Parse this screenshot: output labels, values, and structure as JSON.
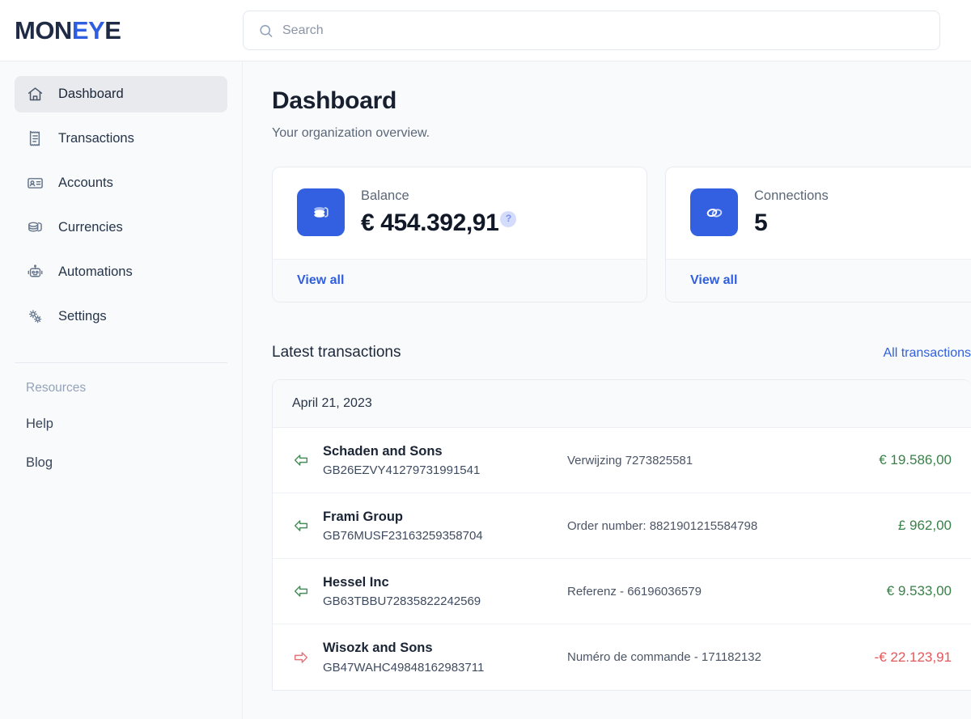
{
  "brand": {
    "name_prefix": "MON",
    "name_accent": "EY",
    "name_suffix": "E",
    "full": "MONEYE",
    "accent_color": "#2f5fe0",
    "dark_color": "#1f2a44"
  },
  "search": {
    "placeholder": "Search",
    "value": "",
    "icon": "search-icon"
  },
  "sidebar": {
    "items": [
      {
        "label": "Dashboard",
        "icon": "home-icon",
        "active": true
      },
      {
        "label": "Transactions",
        "icon": "receipt-icon",
        "active": false
      },
      {
        "label": "Accounts",
        "icon": "id-card-icon",
        "active": false
      },
      {
        "label": "Currencies",
        "icon": "coins-icon",
        "active": false
      },
      {
        "label": "Automations",
        "icon": "robot-icon",
        "active": false
      },
      {
        "label": "Settings",
        "icon": "gears-icon",
        "active": false
      }
    ],
    "resources_label": "Resources",
    "resources": [
      {
        "label": "Help"
      },
      {
        "label": "Blog"
      }
    ]
  },
  "page": {
    "title": "Dashboard",
    "subtitle": "Your organization overview."
  },
  "cards": [
    {
      "label": "Balance",
      "value": "€ 454.392,91",
      "icon": "coins-stack-icon",
      "icon_bg": "#3260e0",
      "help_badge": "?",
      "footer_link": "View all"
    },
    {
      "label": "Connections",
      "value": "5",
      "icon": "link-icon",
      "icon_bg": "#3260e0",
      "help_badge": null,
      "footer_link": "View all"
    }
  ],
  "transactions": {
    "heading": "Latest transactions",
    "all_link": "All transactions",
    "date_group": "April 21, 2023",
    "rows": [
      {
        "direction": "in",
        "name": "Schaden and Sons",
        "iban": "GB26EZVY41279731991541",
        "reference": "Verwijzing 7273825581",
        "amount": "€ 19.586,00",
        "amount_color": "#3a8049"
      },
      {
        "direction": "in",
        "name": "Frami Group",
        "iban": "GB76MUSF23163259358704",
        "reference": "Order number: 8821901215584798",
        "amount": "£ 962,00",
        "amount_color": "#3a8049"
      },
      {
        "direction": "in",
        "name": "Hessel Inc",
        "iban": "GB63TBBU72835822242569",
        "reference": "Referenz - 66196036579",
        "amount": "€ 9.533,00",
        "amount_color": "#3a8049"
      },
      {
        "direction": "out",
        "name": "Wisozk and Sons",
        "iban": "GB47WAHC49848162983711",
        "reference": "Numéro de commande - 171182132",
        "amount": "-€ 22.123,91",
        "amount_color": "#e4575a"
      }
    ]
  }
}
